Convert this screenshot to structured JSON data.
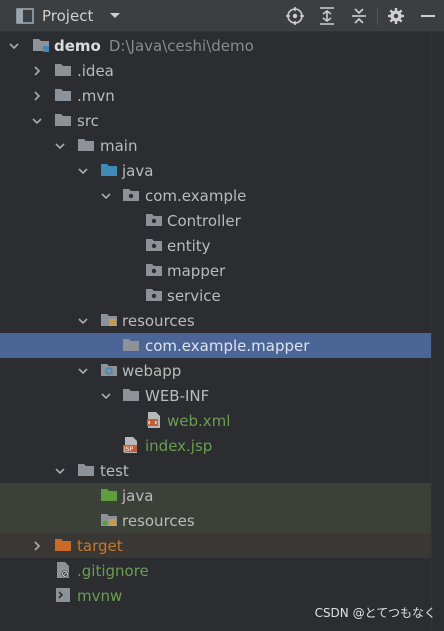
{
  "toolbar": {
    "title": "Project",
    "icons": [
      "locate-icon",
      "expand-all-icon",
      "collapse-all-icon",
      "gear-icon",
      "minimize-icon"
    ]
  },
  "tree": {
    "root_name": "demo",
    "root_path": "D:\\Java\\ceshi\\demo",
    "idea": ".idea",
    "mvn": ".mvn",
    "src": "src",
    "main": "main",
    "java": "java",
    "com_example": "com.example",
    "controller": "Controller",
    "entity": "entity",
    "mapper": "mapper",
    "service": "service",
    "resources": "resources",
    "com_example_mapper": "com.example.mapper",
    "webapp": "webapp",
    "web_inf": "WEB-INF",
    "web_xml": "web.xml",
    "index_jsp": "index.jsp",
    "test": "test",
    "test_java": "java",
    "test_resources": "resources",
    "target": "target",
    "gitignore": ".gitignore",
    "mvnw": "mvnw"
  },
  "watermark": "CSDN @とてつもなく",
  "colors": {
    "background": "#2b2d30",
    "selection": "#4a6596",
    "green_text": "#6a9e52",
    "orange_text": "#c57a2a",
    "folder": "#8c9297",
    "source_folder": "#3f8ab8"
  }
}
